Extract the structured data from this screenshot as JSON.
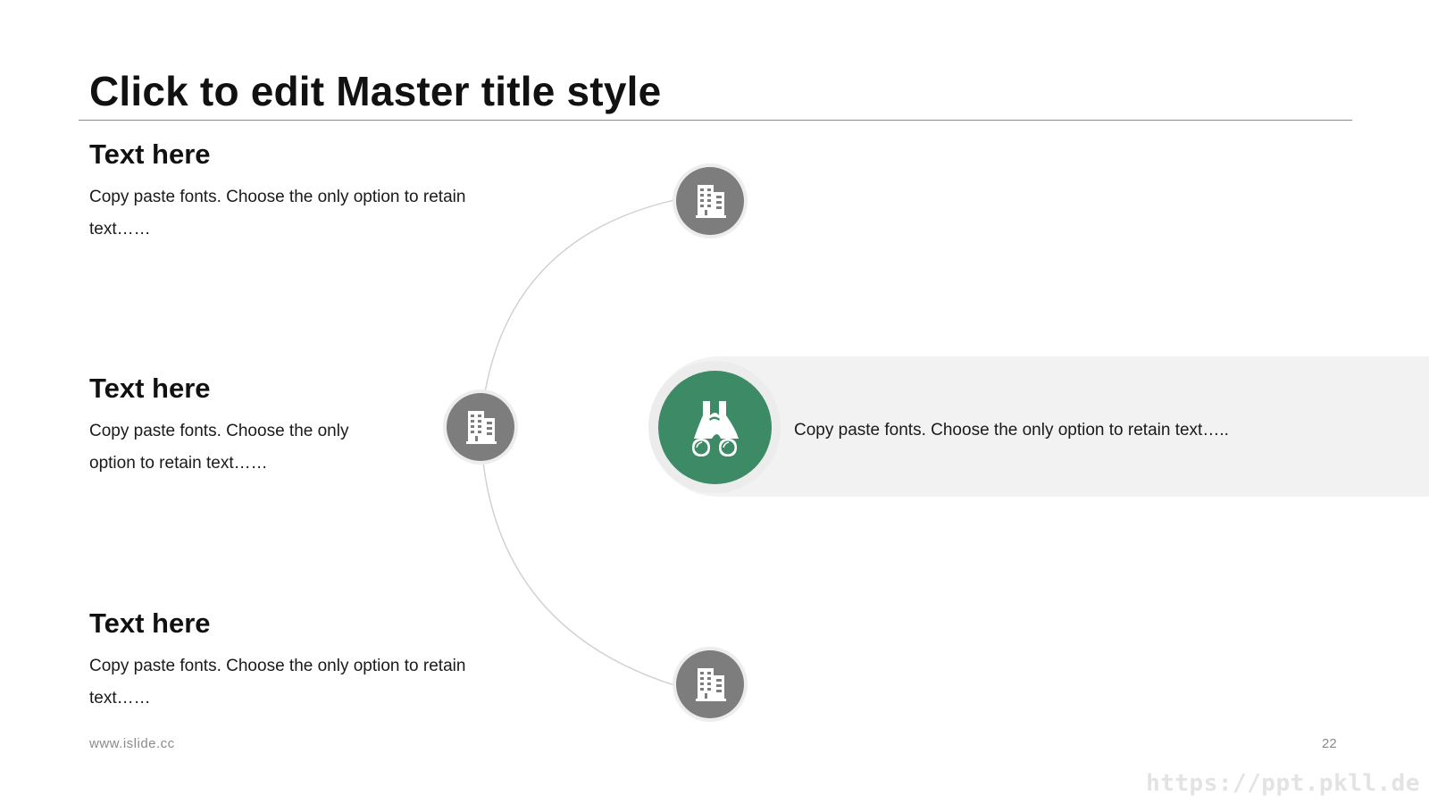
{
  "slide": {
    "title": "Click to edit Master title style",
    "items": [
      {
        "heading": "Text here",
        "text": "Copy paste fonts. Choose the only option to retain text……",
        "icon": "building-icon"
      },
      {
        "heading": "Text here",
        "text": "Copy paste fonts. Choose the only option to retain text……",
        "icon": "building-icon"
      },
      {
        "heading": "Text here",
        "text": "Copy paste fonts. Choose the only option to retain text……",
        "icon": "building-icon"
      }
    ],
    "highlight": {
      "icon": "binoculars-icon",
      "text": "Copy paste fonts. Choose the only option to retain text….."
    }
  },
  "footer": {
    "url": "www.islide.cc",
    "page_number": "22"
  },
  "watermark": "https://ppt.pkll.de",
  "colors": {
    "accent": "#3d8b66",
    "icon_gray": "#7d7d7d",
    "band": "#f2f2f2"
  }
}
